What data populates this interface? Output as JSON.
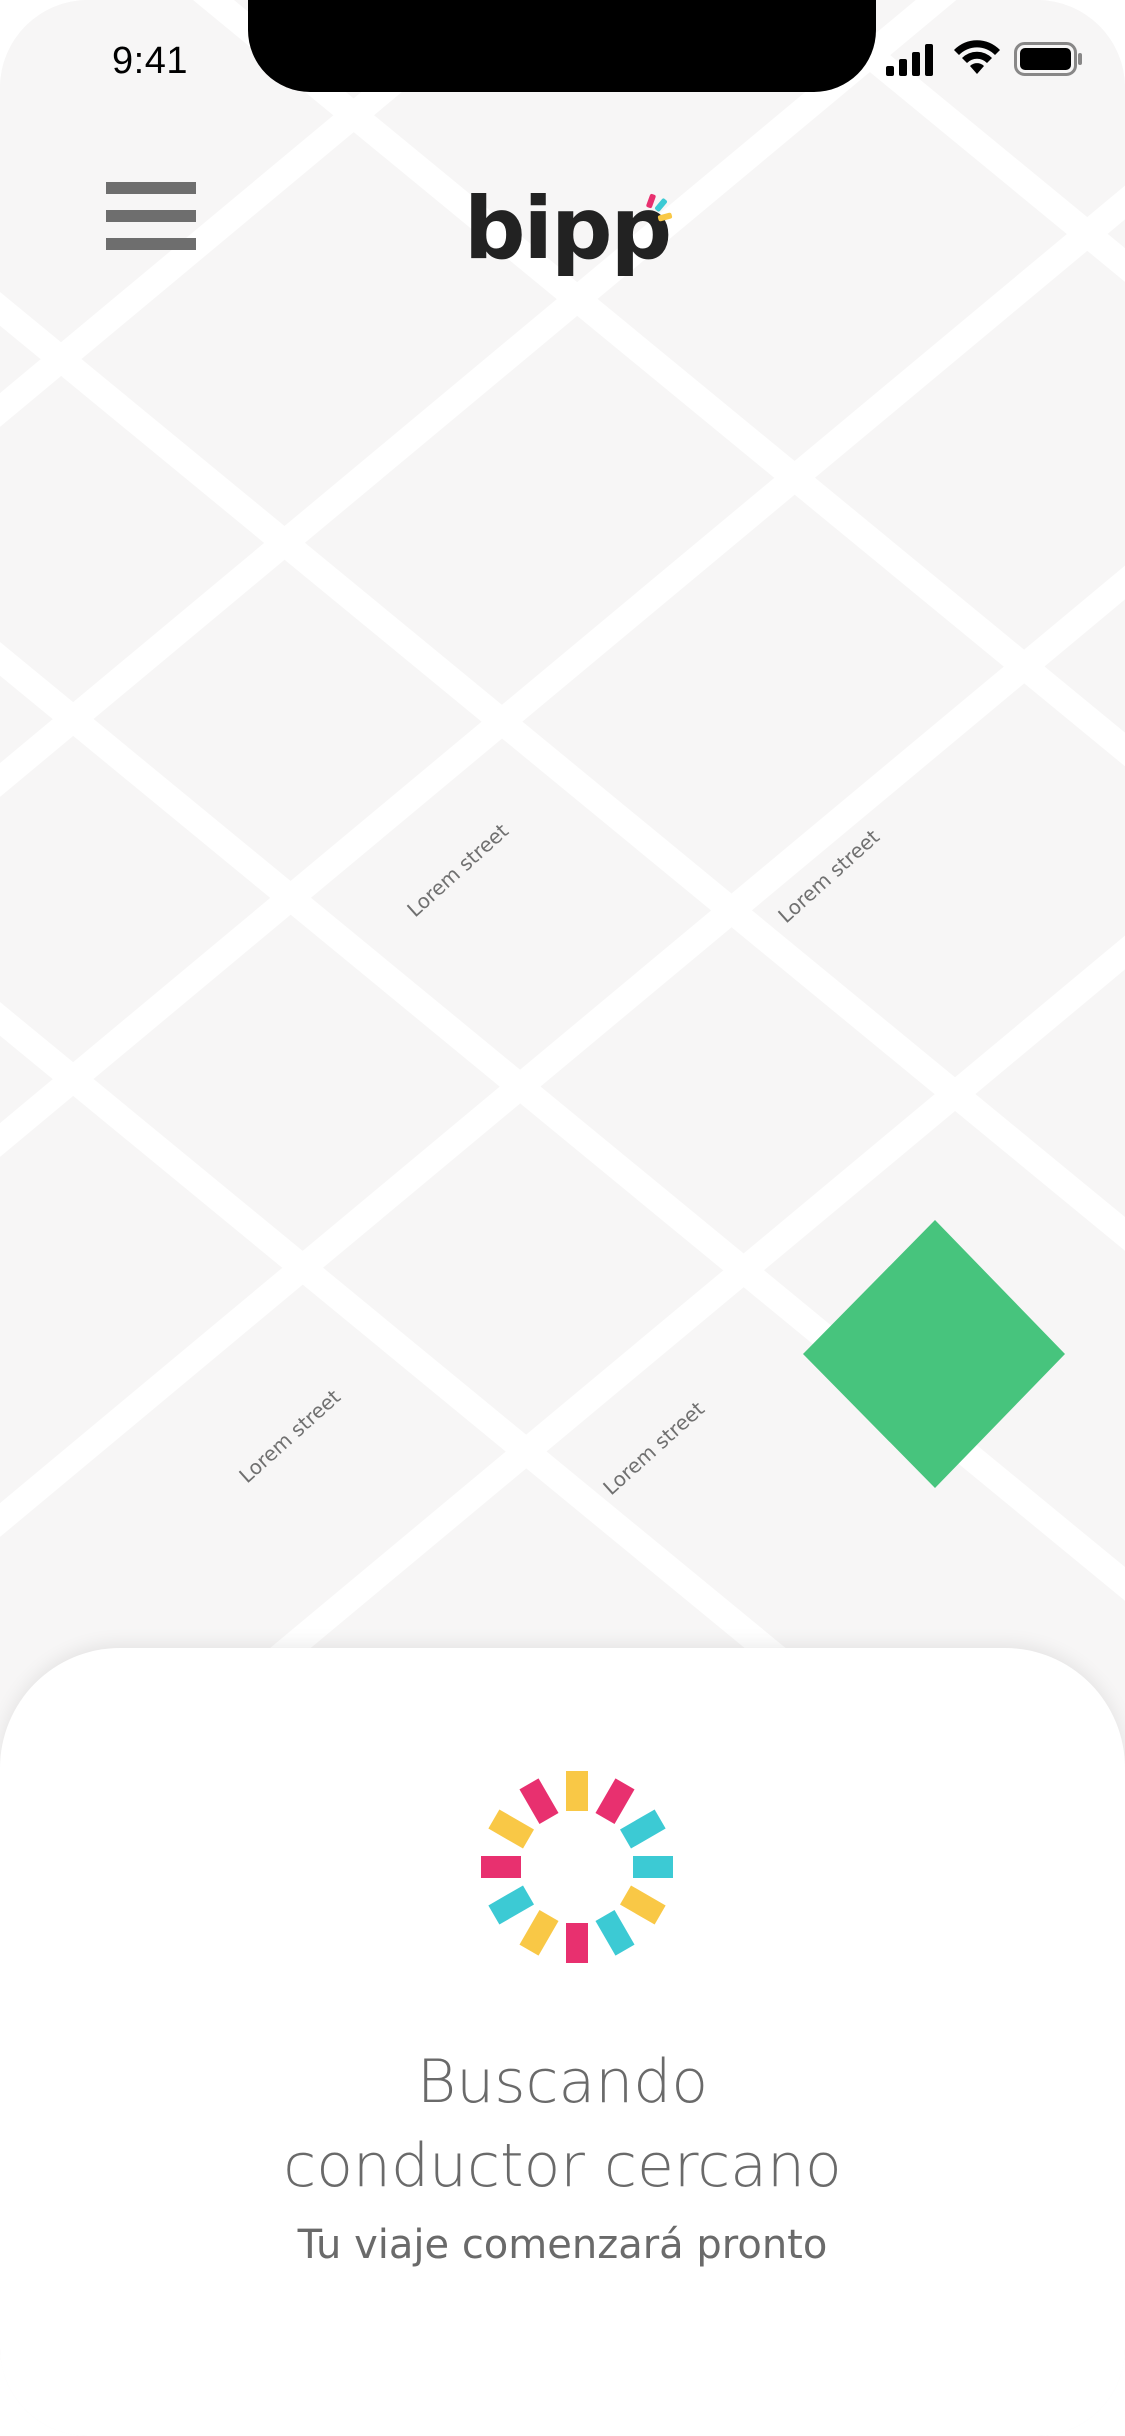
{
  "status_bar": {
    "time": "9:41",
    "icons": [
      "signal-bars-icon",
      "wifi-icon",
      "battery-icon"
    ]
  },
  "header": {
    "menu_icon": "hamburger-menu-icon",
    "logo_text": "bipp"
  },
  "map": {
    "street_labels": [
      "Lorem street",
      "Lorem street",
      "Lorem street",
      "Lorem street"
    ],
    "marker_color": "#47c47d",
    "background_color": "#f7f6f6",
    "road_color": "#ffffff"
  },
  "search_panel": {
    "spinner_icon": "loading-spinner-icon",
    "spinner_colors": [
      "#f9c846",
      "#3ccad4",
      "#e8306f"
    ],
    "title_line1": "Buscando",
    "title_line2": "conductor cercano",
    "subtitle": "Tu viaje comenzará pronto"
  }
}
